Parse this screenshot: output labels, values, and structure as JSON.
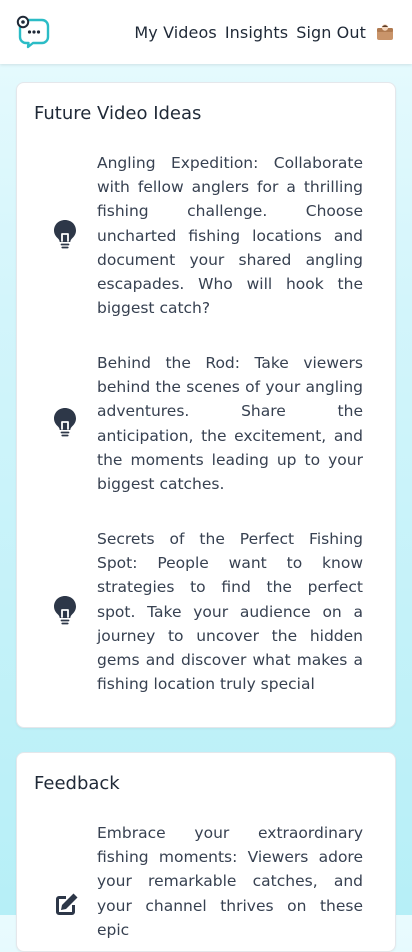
{
  "nav": {
    "links": [
      "My Videos",
      "Insights",
      "Sign Out"
    ]
  },
  "icons": {
    "logo": "chat-bubble-logo-icon",
    "avatar": "user-avatar-icon",
    "idea": "lightbulb-icon",
    "feedback": "pencil-edit-icon"
  },
  "colors": {
    "icon": "#2d3748",
    "logo": "#2bbcc6",
    "text": "#374151",
    "background": "#c6f2f8"
  },
  "ideas": {
    "title": "Future Video Ideas",
    "items": [
      {
        "text": "Angling Expedition: Collaborate with fellow anglers for a thrilling fishing challenge. Choose uncharted fishing locations and document your shared angling escapades. Who will hook the biggest catch?"
      },
      {
        "text": "Behind the Rod: Take viewers behind the scenes of your angling adventures. Share the anticipation, the excitement, and the moments leading up to your biggest catches."
      },
      {
        "text": "Secrets of the Perfect Fishing Spot: People want to know strategies to find the perfect spot. Take your audience on a journey to uncover the hidden gems and discover what makes a fishing location truly special"
      }
    ]
  },
  "feedback": {
    "title": "Feedback",
    "items": [
      {
        "text": "Embrace your extraordinary fishing moments: Viewers adore your remarkable catches, and your channel thrives on these epic"
      }
    ]
  }
}
